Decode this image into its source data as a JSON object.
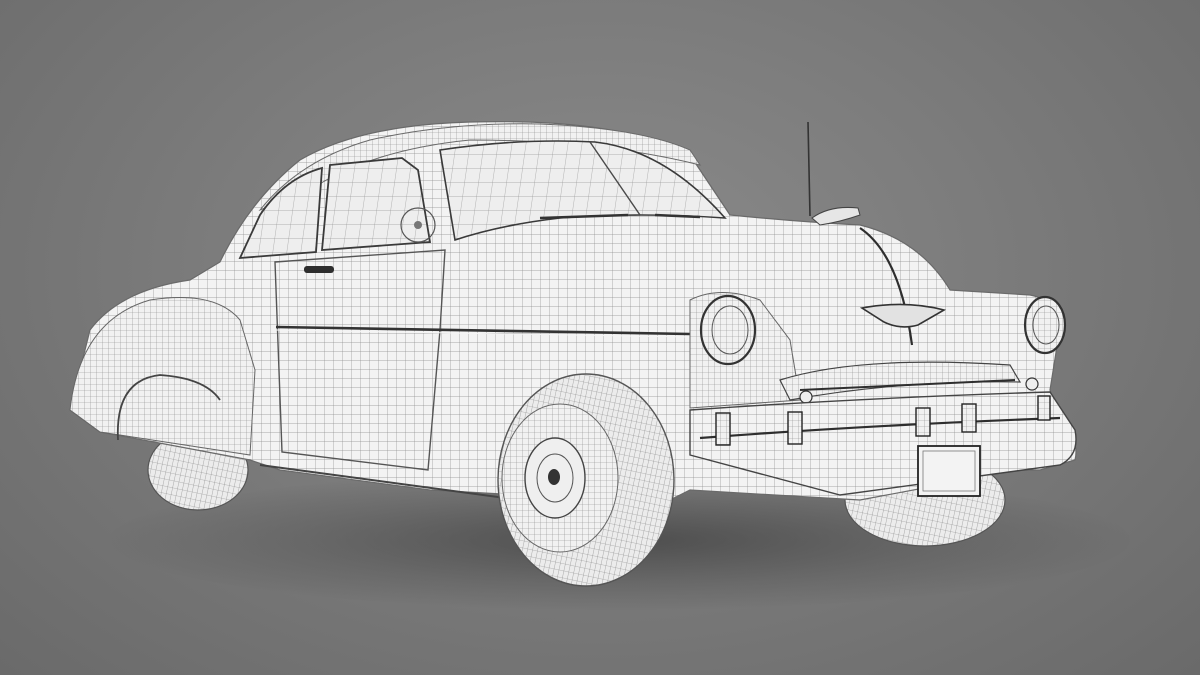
{
  "scene": {
    "subject": "car-wireframe",
    "colors": {
      "background": "#7c7c7c",
      "mesh_surface": "#f2f2f2",
      "wire": "#8c8c8c",
      "trim": "#3a3a3a",
      "chrome": "#e8e8e8",
      "glass": "#ededed"
    }
  }
}
